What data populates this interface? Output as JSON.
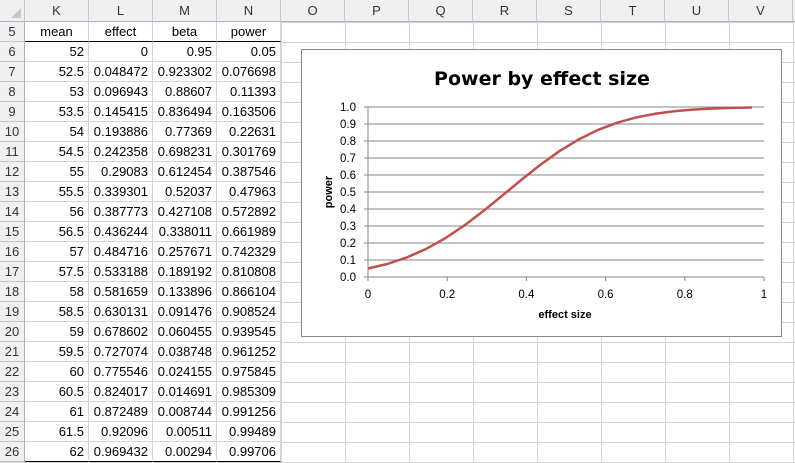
{
  "sheet": {
    "columns": [
      "K",
      "L",
      "M",
      "N",
      "O",
      "P",
      "Q",
      "R",
      "S",
      "T",
      "U",
      "V"
    ],
    "row_numbers": [
      "5",
      "6",
      "7",
      "8",
      "9",
      "10",
      "11",
      "12",
      "13",
      "14",
      "15",
      "16",
      "17",
      "18",
      "19",
      "20",
      "21",
      "22",
      "23",
      "24",
      "25",
      "26"
    ],
    "headers": [
      "mean",
      "effect",
      "beta",
      "power"
    ],
    "rows": [
      [
        "52",
        "0",
        "0.95",
        "0.05"
      ],
      [
        "52.5",
        "0.048472",
        "0.923302",
        "0.076698"
      ],
      [
        "53",
        "0.096943",
        "0.88607",
        "0.11393"
      ],
      [
        "53.5",
        "0.145415",
        "0.836494",
        "0.163506"
      ],
      [
        "54",
        "0.193886",
        "0.77369",
        "0.22631"
      ],
      [
        "54.5",
        "0.242358",
        "0.698231",
        "0.301769"
      ],
      [
        "55",
        "0.29083",
        "0.612454",
        "0.387546"
      ],
      [
        "55.5",
        "0.339301",
        "0.52037",
        "0.47963"
      ],
      [
        "56",
        "0.387773",
        "0.427108",
        "0.572892"
      ],
      [
        "56.5",
        "0.436244",
        "0.338011",
        "0.661989"
      ],
      [
        "57",
        "0.484716",
        "0.257671",
        "0.742329"
      ],
      [
        "57.5",
        "0.533188",
        "0.189192",
        "0.810808"
      ],
      [
        "58",
        "0.581659",
        "0.133896",
        "0.866104"
      ],
      [
        "58.5",
        "0.630131",
        "0.091476",
        "0.908524"
      ],
      [
        "59",
        "0.678602",
        "0.060455",
        "0.939545"
      ],
      [
        "59.5",
        "0.727074",
        "0.038748",
        "0.961252"
      ],
      [
        "60",
        "0.775546",
        "0.024155",
        "0.975845"
      ],
      [
        "60.5",
        "0.824017",
        "0.014691",
        "0.985309"
      ],
      [
        "61",
        "0.872489",
        "0.008744",
        "0.991256"
      ],
      [
        "61.5",
        "0.92096",
        "0.00511",
        "0.99489"
      ],
      [
        "62",
        "0.969432",
        "0.00294",
        "0.99706"
      ]
    ]
  },
  "chart_data": {
    "type": "line",
    "title": "Power by effect size",
    "xlabel": "effect size",
    "ylabel": "power",
    "xlim": [
      0,
      1
    ],
    "ylim": [
      0,
      1
    ],
    "xticks": [
      "0",
      "0.2",
      "0.4",
      "0.6",
      "0.8",
      "1"
    ],
    "yticks": [
      "0.0",
      "0.1",
      "0.2",
      "0.3",
      "0.4",
      "0.5",
      "0.6",
      "0.7",
      "0.8",
      "0.9",
      "1.0"
    ],
    "grid": true,
    "legend": "none",
    "line_color": "#c0504d",
    "x": [
      0,
      0.048472,
      0.096943,
      0.145415,
      0.193886,
      0.242358,
      0.29083,
      0.339301,
      0.387773,
      0.436244,
      0.484716,
      0.533188,
      0.581659,
      0.630131,
      0.678602,
      0.727074,
      0.775546,
      0.824017,
      0.872489,
      0.92096,
      0.969432
    ],
    "y": [
      0.05,
      0.076698,
      0.11393,
      0.163506,
      0.22631,
      0.301769,
      0.387546,
      0.47963,
      0.572892,
      0.661989,
      0.742329,
      0.810808,
      0.866104,
      0.908524,
      0.939545,
      0.961252,
      0.975845,
      0.985309,
      0.991256,
      0.99489,
      0.99706
    ]
  }
}
